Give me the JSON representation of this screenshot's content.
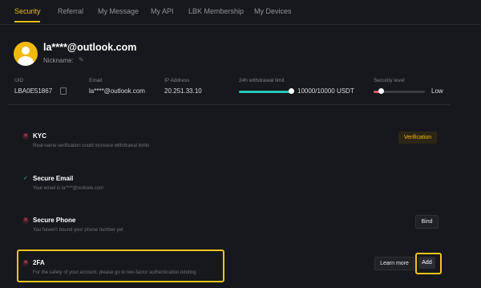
{
  "tabs": [
    {
      "label": "Security",
      "active": true
    },
    {
      "label": "Referral",
      "active": false
    },
    {
      "label": "My Message",
      "active": false
    },
    {
      "label": "My API",
      "active": false
    },
    {
      "label": "LBK Membership",
      "active": false
    },
    {
      "label": "My Devices",
      "active": false
    }
  ],
  "profile": {
    "email": "la****@outlook.com",
    "nickname_label": "Nickname:",
    "avatar_icon": "user-avatar-icon",
    "edit_icon": "pencil-icon"
  },
  "info": {
    "uid_label": "UID",
    "uid_value": "LBA0E51867",
    "email_label": "Email",
    "email_value": "la****@outlook.com",
    "ip_label": "IP Address",
    "ip_value": "20.251.33.10",
    "limit_label": "24h withdrawal limit",
    "limit_value": "10000/10000 USDT",
    "limit_fraction": 1.0,
    "security_label": "Security level",
    "security_value": "Low"
  },
  "items": [
    {
      "title": "KYC",
      "desc": "Real-name verification could increase withdrawal limits",
      "status": "error",
      "action": "Verification"
    },
    {
      "title": "Secure Email",
      "desc": "Your email is la****@outlook.com",
      "status": "ok"
    },
    {
      "title": "Secure Phone",
      "desc": "You haven't bound your phone number yet",
      "status": "error",
      "action": "Bind"
    },
    {
      "title": "2FA",
      "desc": "For the safety of your account, please go to two-factor authentication binding",
      "status": "error",
      "secondary_action": "Learn more",
      "action": "Add"
    }
  ],
  "colors": {
    "accent": "#f0b90b",
    "success": "#27c4b5",
    "error": "#e05262",
    "highlight": "#f0c419"
  }
}
